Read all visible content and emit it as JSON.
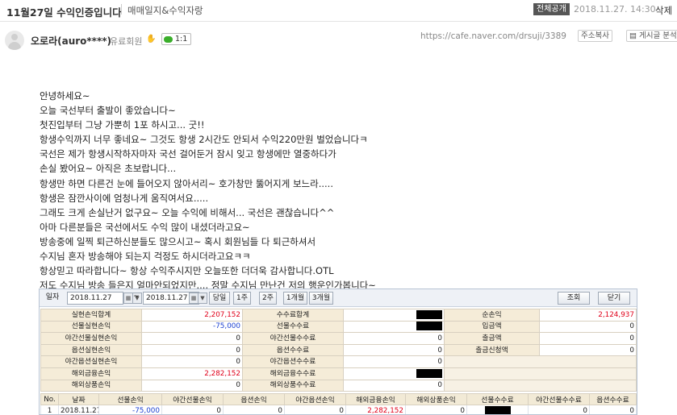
{
  "header": {
    "title": "11월27일 수익인증입니다",
    "board": "매매일지&수익자랑",
    "public_badge": "전체공개",
    "date": "2018.11.27. 14:30",
    "delete": "삭제"
  },
  "author": {
    "name": "오로라(auro****)",
    "grade": "유료회원",
    "grade_icon": "hand-icon",
    "chat_count": "1:1",
    "url": "https://cafe.naver.com/drsuji/3389",
    "copy_url": "주소복사",
    "board_search": "게시글 분석"
  },
  "body_lines": [
    "안녕하세요~",
    "오늘 국선부터 출발이 좋았습니다~",
    "첫진입부터 그냥 가뿐히 1포 하시고... 굿!!",
    "항생수익까지 너무 좋네요~ 그것도 항생 2시간도 안되서 수익220만원 벌었습니다ㅋ",
    "국선은 제가 항생시작하자마자 국선 걸어둔거 잠시 잊고 항생에만 열중하다가",
    "손실 봤어요~ 아직은 초보랍니다...",
    "항생만 하면 다른건 눈에 들어오지 않아서리~ 호가창만 뚫어지게 보느라.....",
    "항생은 잠깐사이에 엄청나게 움직여서요.....",
    "그래도 크게 손실난거 없구요~ 오늘 수익에 비해서... 국선은 괜찮습니다^^",
    "아마 다른분들은 국선에서도 수익 많이 내셨더라고요~",
    "방송중에 일찍 퇴근하신분들도 많으시고~ 혹시 회원님들 다 퇴근하셔서",
    "수지님 혼자 방송해야 되는지 걱정도 하시더라고요ㅋㅋ",
    "항상믿고 따라합니다~ 항상 수익주시지만 오늘또한 더더욱 감사합니다.OTL",
    "저도 수지님 방송 들은지 얼마안되었지만.... 정말 수지님 만난건 저의 행운인가봅니다~"
  ],
  "trade": {
    "toolbar": {
      "date_label": "일자",
      "date_from": "2018.11.27",
      "date_to": "2018.11.27",
      "tilde": "~",
      "today": "당일",
      "week1": "1주",
      "week2": "2주",
      "month1": "1개월",
      "month3": "3개월",
      "search": "조회",
      "close": "닫기"
    },
    "summary": {
      "r1": {
        "l1": "실현손익합계",
        "v1": "2,207,152",
        "l2": "수수료합계",
        "l3": "순손익",
        "v3": "2,124,937"
      },
      "r2": {
        "l1": "선물실현손익",
        "v1": "-75,000",
        "l2": "선물수수료",
        "l3": "입금액",
        "v3": "0"
      },
      "r3": {
        "l1": "야간선물실현손익",
        "v1": "0",
        "l2": "야간선물수수료",
        "v2": "0",
        "l3": "출금액",
        "v3": "0"
      },
      "r4": {
        "l1": "옵션실현손익",
        "v1": "0",
        "l2": "옵션수수료",
        "v2": "0",
        "l3": "출금신청액",
        "v3": "0"
      },
      "r5": {
        "l1": "야간옵션실현손익",
        "v1": "0",
        "l2": "야간옵션수수료",
        "v2": "0"
      },
      "r6": {
        "l1": "해외금융손익",
        "v1": "2,282,152",
        "l2": "해외금융수수료"
      },
      "r7": {
        "l1": "해외상품손익",
        "v1": "0",
        "l2": "해외상품수수료",
        "v2": "0"
      }
    },
    "detail_headers": [
      "No.",
      "날짜",
      "선물손익",
      "야간선물손익",
      "옵션손익",
      "야간옵션손익",
      "해외금융손익",
      "해외상품손익",
      "선물수수료",
      "야간선물수수료",
      "옵션수수료"
    ],
    "detail_row": {
      "no": "1",
      "date": "2018.11.27",
      "futures": "-75,000",
      "night_futures": "0",
      "options": "0",
      "night_options": "0",
      "overseas_fin": "2,282,152",
      "overseas_goods": "0",
      "night_futures_fee": "0",
      "options_fee": "0"
    },
    "colors": {
      "positive": "#e0001a",
      "negative": "#1a3fd0",
      "label_bg": "#f5ecd8"
    }
  }
}
